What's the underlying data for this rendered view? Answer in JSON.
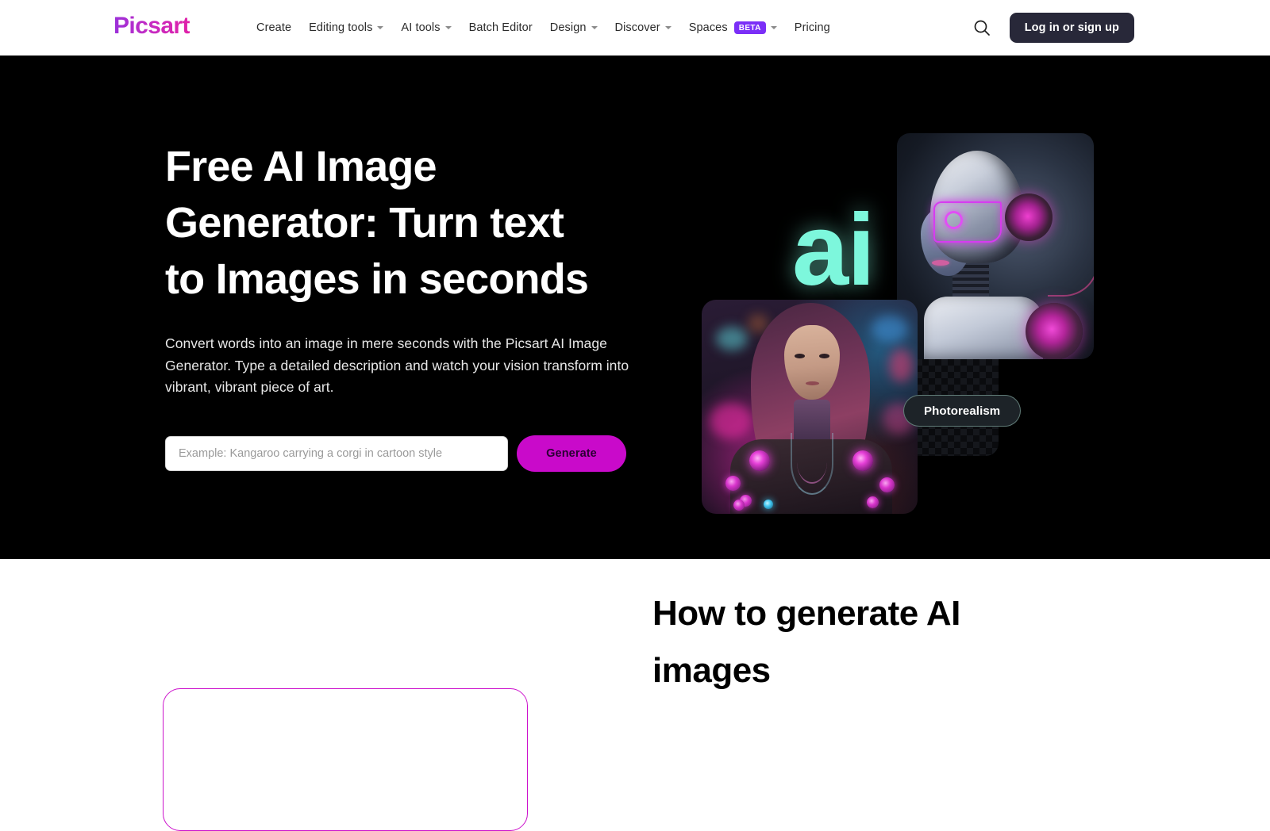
{
  "header": {
    "logo_text": "Picsart",
    "nav_items": [
      {
        "label": "Create",
        "has_dropdown": false,
        "badge": null
      },
      {
        "label": "Editing tools",
        "has_dropdown": true,
        "badge": null
      },
      {
        "label": "AI tools",
        "has_dropdown": true,
        "badge": null
      },
      {
        "label": "Batch Editor",
        "has_dropdown": false,
        "badge": null
      },
      {
        "label": "Design",
        "has_dropdown": true,
        "badge": null
      },
      {
        "label": "Discover",
        "has_dropdown": true,
        "badge": null
      },
      {
        "label": "Spaces",
        "has_dropdown": true,
        "badge": "BETA"
      },
      {
        "label": "Pricing",
        "has_dropdown": false,
        "badge": null
      }
    ],
    "search_icon": "search-icon",
    "login_label": "Log in or sign up"
  },
  "hero": {
    "title": "Free AI Image\nGenerator: Turn text\nto Images in seconds",
    "subtitle": "Convert words into an image in mere seconds with the Picsart AI Image Generator. Type a detailed description and watch your vision transform into vibrant, vibrant piece of art.",
    "prompt_placeholder": "Example: Kangaroo carrying a corgi in cartoon style",
    "prompt_value": "",
    "generate_label": "Generate",
    "art": {
      "ai_mark": "ai",
      "style_pill": "Photorealism"
    }
  },
  "lower": {
    "how_title": "How to generate AI\nimages"
  },
  "colors": {
    "brand_magenta": "#CC12CC",
    "brand_purple": "#7B2FF7",
    "generate_button": "#C90ACA",
    "login_button": "#282839",
    "hero_background": "#000000",
    "ai_mark_cyan": "#7DF7DC",
    "page_background": "#FFFFFF"
  }
}
